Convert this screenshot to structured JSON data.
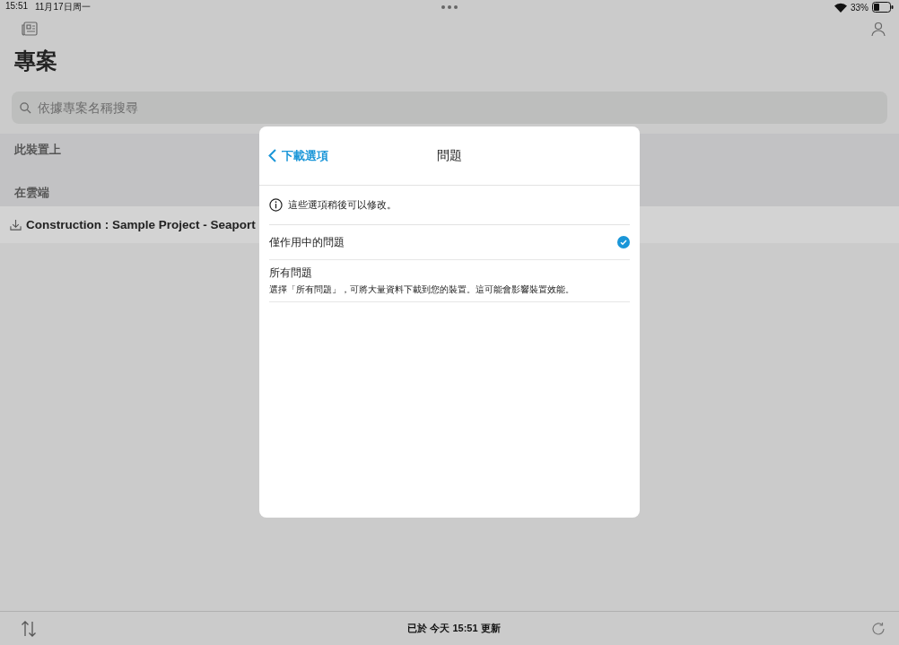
{
  "status_bar": {
    "time": "15:51",
    "date": "11月17日周一",
    "battery": "33%"
  },
  "page_title": "專案",
  "search": {
    "placeholder": "依據專案名稱搜尋"
  },
  "sections": [
    {
      "title": "此裝置上"
    },
    {
      "title": "在雲端",
      "items": [
        {
          "name": "Construction : Sample Project - Seaport"
        }
      ]
    }
  ],
  "dialog": {
    "back": "下載選項",
    "title": "問題",
    "info": "這些選項稍後可以修改。",
    "options": [
      {
        "label": "僅作用中的問題",
        "selected": true
      },
      {
        "label": "所有問題",
        "description": "選擇「所有問題」，可將大量資料下載到您的裝置。這可能會影響裝置效能。",
        "selected": false
      }
    ]
  },
  "footer": {
    "updated": "已於 今天 15:51 更新"
  }
}
